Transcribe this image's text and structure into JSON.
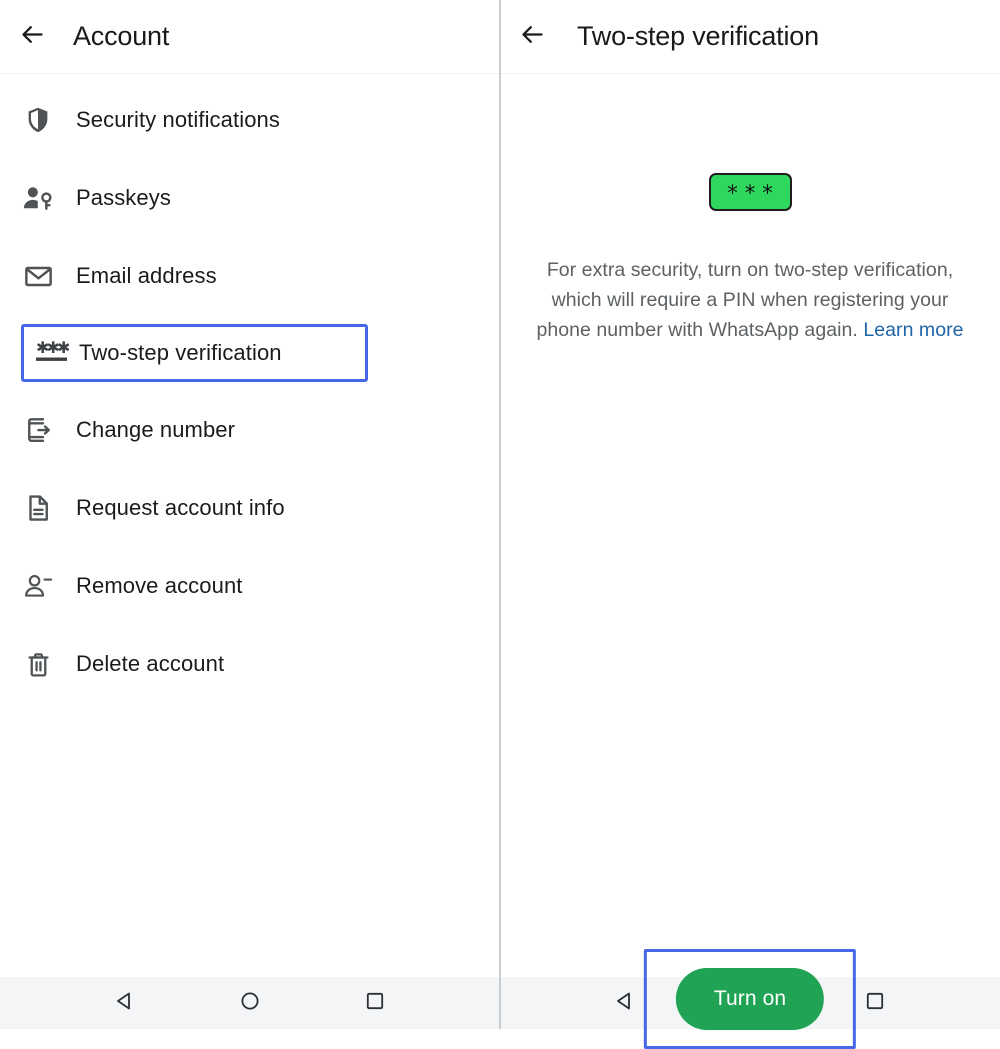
{
  "left_panel": {
    "header": {
      "back_icon": "arrow-left-icon",
      "title": "Account"
    },
    "items": [
      {
        "label": "Security notifications",
        "icon": "shield-icon",
        "highlighted": false
      },
      {
        "label": "Passkeys",
        "icon": "person-key-icon",
        "highlighted": false
      },
      {
        "label": "Email address",
        "icon": "envelope-icon",
        "highlighted": false
      },
      {
        "label": "Two-step verification",
        "icon": "asterisks-icon",
        "highlighted": true
      },
      {
        "label": "Change number",
        "icon": "phone-arrow-icon",
        "highlighted": false
      },
      {
        "label": "Request account info",
        "icon": "document-icon",
        "highlighted": false
      },
      {
        "label": "Remove account",
        "icon": "person-minus-icon",
        "highlighted": false
      },
      {
        "label": "Delete account",
        "icon": "trash-icon",
        "highlighted": false
      }
    ]
  },
  "right_panel": {
    "header": {
      "back_icon": "arrow-left-icon",
      "title": "Two-step verification"
    },
    "hero": {
      "icon": "green-asterisks-pin-icon",
      "asterisks": [
        "*",
        "*",
        "*"
      ]
    },
    "description": {
      "text": "For extra security, turn on two-step verification, which will require a PIN when registering your phone number with WhatsApp again. ",
      "link_text": "Learn more"
    },
    "cta": {
      "label": "Turn on"
    }
  },
  "navbar": {
    "buttons": [
      {
        "name": "back",
        "icon": "triangle-back-icon"
      },
      {
        "name": "home",
        "icon": "circle-home-icon"
      },
      {
        "name": "recents",
        "icon": "square-recents-icon"
      }
    ]
  },
  "colors": {
    "accent_green": "#21a356",
    "hero_green": "#2ed85f",
    "highlight_blue": "#4668e8",
    "link_blue": "#2065a8",
    "text_primary": "#1b1b1b",
    "text_secondary": "#5d6164",
    "icon_gray": "#4f5356",
    "navbar_bg": "#f4f5f7"
  }
}
